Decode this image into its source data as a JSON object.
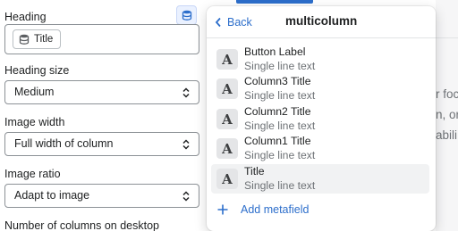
{
  "settings": {
    "heading": {
      "label": "Heading",
      "dynamic_source_pill": "Title",
      "dynamic_icon": "database-icon"
    },
    "heading_size": {
      "label": "Heading size",
      "value": "Medium"
    },
    "image_width": {
      "label": "Image width",
      "value": "Full width of column"
    },
    "image_ratio": {
      "label": "Image ratio",
      "value": "Adapt to image"
    },
    "columns_desktop": {
      "label": "Number of columns on desktop"
    }
  },
  "popover": {
    "back_label": "Back",
    "title": "multicolumn",
    "options": [
      {
        "name": "Button Label",
        "type": "Single line text",
        "icon": "text-type-icon",
        "active": false
      },
      {
        "name": "Column3 Title",
        "type": "Single line text",
        "icon": "text-type-icon",
        "active": false
      },
      {
        "name": "Column2 Title",
        "type": "Single line text",
        "icon": "text-type-icon",
        "active": false
      },
      {
        "name": "Column1 Title",
        "type": "Single line text",
        "icon": "text-type-icon",
        "active": false
      },
      {
        "name": "Title",
        "type": "Single line text",
        "icon": "text-type-icon",
        "active": true
      }
    ],
    "add_metafield_label": "Add metafield",
    "type_glyph": "A"
  },
  "background": {
    "fragments": [
      "r focu",
      "n, or",
      "abili"
    ]
  },
  "colors": {
    "accent": "#2c6ecb",
    "text": "#202223",
    "subdued": "#6d7175",
    "border": "#8c9196"
  }
}
